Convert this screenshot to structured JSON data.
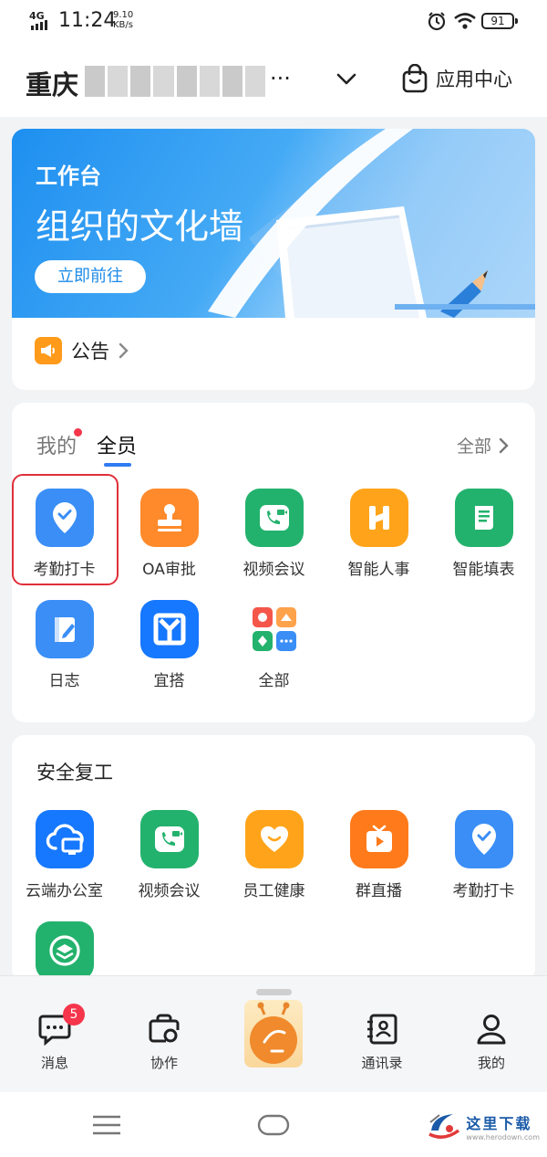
{
  "status_bar": {
    "network": "4G",
    "time": "11:24",
    "speed_value": "9.10",
    "speed_unit": "KB/s",
    "battery": "91"
  },
  "header": {
    "org_name": "重庆",
    "ellipsis": "···",
    "app_center_label": "应用中心"
  },
  "banner": {
    "subtitle": "工作台",
    "title": "组织的文化墙",
    "button_label": "立即前往"
  },
  "notice": {
    "label": "公告"
  },
  "apps_card": {
    "tabs": [
      {
        "label": "我的"
      },
      {
        "label": "全员"
      }
    ],
    "all_label": "全部",
    "apps": [
      {
        "label": "考勤打卡",
        "icon": "location-check-icon",
        "color": "#3a8ef6"
      },
      {
        "label": "OA审批",
        "icon": "stamp-icon",
        "color": "#ff8a2b"
      },
      {
        "label": "视频会议",
        "icon": "video-call-icon",
        "color": "#23b26d"
      },
      {
        "label": "智能人事",
        "icon": "hr-icon",
        "color": "#ffa41a"
      },
      {
        "label": "智能填表",
        "icon": "form-icon",
        "color": "#23b26d"
      },
      {
        "label": "日志",
        "icon": "journal-icon",
        "color": "#3a8ef6"
      },
      {
        "label": "宜搭",
        "icon": "yida-icon",
        "color": "#1677ff"
      },
      {
        "label": "全部",
        "icon": "all-apps-icon",
        "color": "#ffffff"
      }
    ]
  },
  "safety_card": {
    "title": "安全复工",
    "apps": [
      {
        "label": "云端办公室",
        "icon": "cloud-office-icon",
        "color": "#1677ff"
      },
      {
        "label": "视频会议",
        "icon": "video-call-icon",
        "color": "#23b26d"
      },
      {
        "label": "员工健康",
        "icon": "heart-icon",
        "color": "#ffa41a"
      },
      {
        "label": "群直播",
        "icon": "live-tv-icon",
        "color": "#ff7a1a"
      },
      {
        "label": "考勤打卡",
        "icon": "location-check-icon",
        "color": "#3a8ef6"
      },
      {
        "label": "",
        "icon": "layers-icon",
        "color": "#23b26d"
      }
    ]
  },
  "bottom_nav": {
    "items": [
      {
        "label": "消息",
        "icon": "message-icon",
        "badge": "5"
      },
      {
        "label": "协作",
        "icon": "collaborate-icon"
      },
      {
        "label": "",
        "icon": "mascot-icon"
      },
      {
        "label": "通讯录",
        "icon": "contacts-icon"
      },
      {
        "label": "我的",
        "icon": "profile-icon"
      }
    ]
  },
  "watermark": {
    "text": "这里下载",
    "sub": "www.herodown.com"
  }
}
